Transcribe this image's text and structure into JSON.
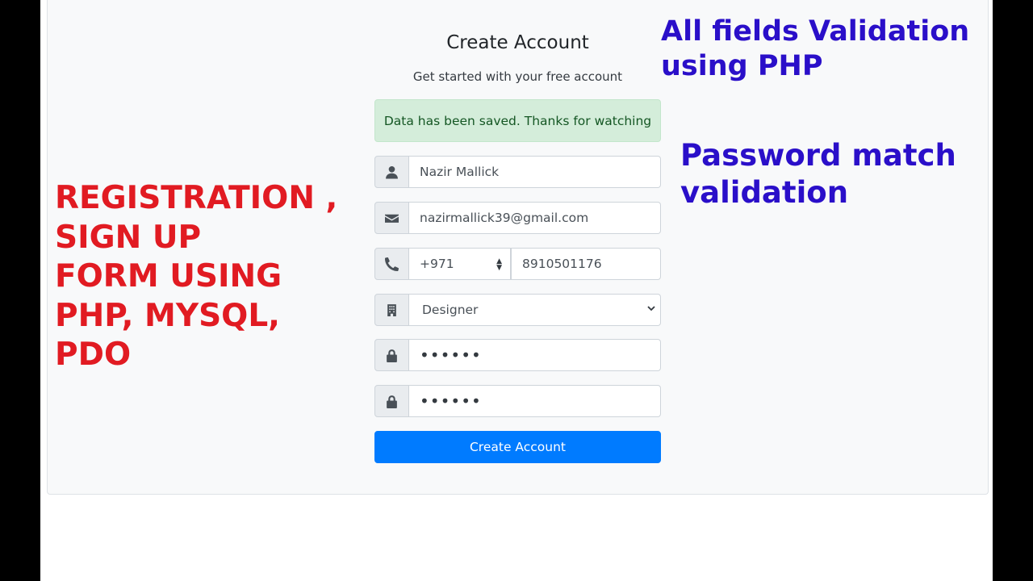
{
  "form": {
    "title": "Create Account",
    "subtitle": "Get started with your free account",
    "alert": "Data has been saved. Thanks for watching",
    "name_value": "Nazir Mallick",
    "email_value": "nazirmallick39@gmail.com",
    "country_code": "+971",
    "phone_value": "8910501176",
    "job_type": "Designer",
    "password_mask": "••••••",
    "repeat_password_mask": "••••••",
    "submit_label": "Create Account"
  },
  "overlay": {
    "left_title_lines": [
      "REGISTRATION ,",
      "SIGN UP",
      "FORM USING",
      "PHP, MYSQL,",
      "PDO"
    ],
    "right_top_lines": [
      "All fields Validation",
      "using PHP"
    ],
    "right_mid_lines": [
      "Password match",
      "validation"
    ]
  },
  "icons": {
    "name": "user-icon",
    "email": "envelope-icon",
    "phone": "phone-icon",
    "job": "building-icon",
    "password": "lock-icon",
    "repeat_password": "lock-icon",
    "spinner": "updown-arrows-icon",
    "select": "chevron-down-icon"
  },
  "colors": {
    "primary": "#007bff",
    "alert_bg": "#d4edda",
    "alert_text": "#155724",
    "overlay_red": "#e11b22",
    "overlay_blue": "#2a0fc9"
  }
}
